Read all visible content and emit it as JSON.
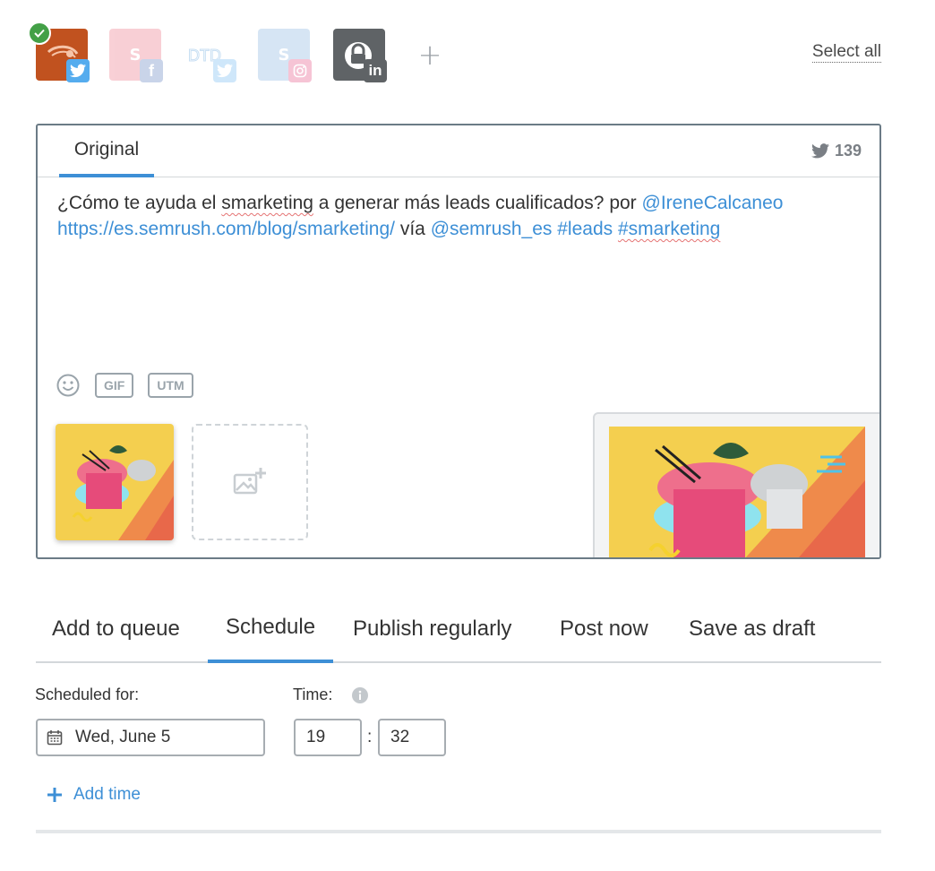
{
  "accounts": [
    {
      "name": "semrush-twitter-account",
      "network": "twitter",
      "selected": true,
      "avatar_color": "#c1521f",
      "badge_color": "#55acee"
    },
    {
      "name": "semrush-facebook-account",
      "network": "facebook",
      "selected": false,
      "avatar_letter": "S",
      "avatar_color": "#e8556b",
      "badge_color": "#4267b2"
    },
    {
      "name": "dtd-twitter-account",
      "network": "twitter",
      "selected": false,
      "avatar_color": "#ffffff",
      "badge_color": "#55acee"
    },
    {
      "name": "semrush-instagram-account",
      "network": "instagram",
      "selected": false,
      "avatar_letter": "S",
      "avatar_color": "#6ea6d8",
      "badge_color": "#e1306c"
    },
    {
      "name": "linkedin-locked-account",
      "network": "linkedin",
      "selected": false,
      "avatar_color": "#5f6366",
      "badge_color": "#5f6366"
    }
  ],
  "select_all": "Select all",
  "editor": {
    "tab_label": "Original",
    "char_count": "139",
    "post_plain_1": "¿Cómo te ayuda el ",
    "post_squiggle_1": "smarketing",
    "post_plain_2": " a generar más leads cualificados? por ",
    "post_mention_1": "@IreneCalcaneo",
    "post_url": "https://es.semrush.com/blog/smarketing/",
    "post_plain_3": " vía ",
    "post_mention_2": "@semrush_es",
    "post_hashtag_1": "#leads",
    "post_hashtag_2": "#smarketing",
    "gif_label": "GIF",
    "utm_label": "UTM"
  },
  "publish_tabs": [
    {
      "label": "Add to queue",
      "active": false
    },
    {
      "label": "Schedule",
      "active": true
    },
    {
      "label": "Publish regularly",
      "active": false
    },
    {
      "label": "Post now",
      "active": false
    },
    {
      "label": "Save as draft",
      "active": false
    }
  ],
  "schedule": {
    "scheduled_for_label": "Scheduled for:",
    "date_value": "Wed, June 5",
    "time_label": "Time:",
    "hour": "19",
    "minute": "32",
    "separator": ":",
    "add_time_label": "Add time"
  },
  "colors": {
    "accent": "#3d8fd6",
    "border": "#6b7b86",
    "muted": "#9aa4ab"
  }
}
